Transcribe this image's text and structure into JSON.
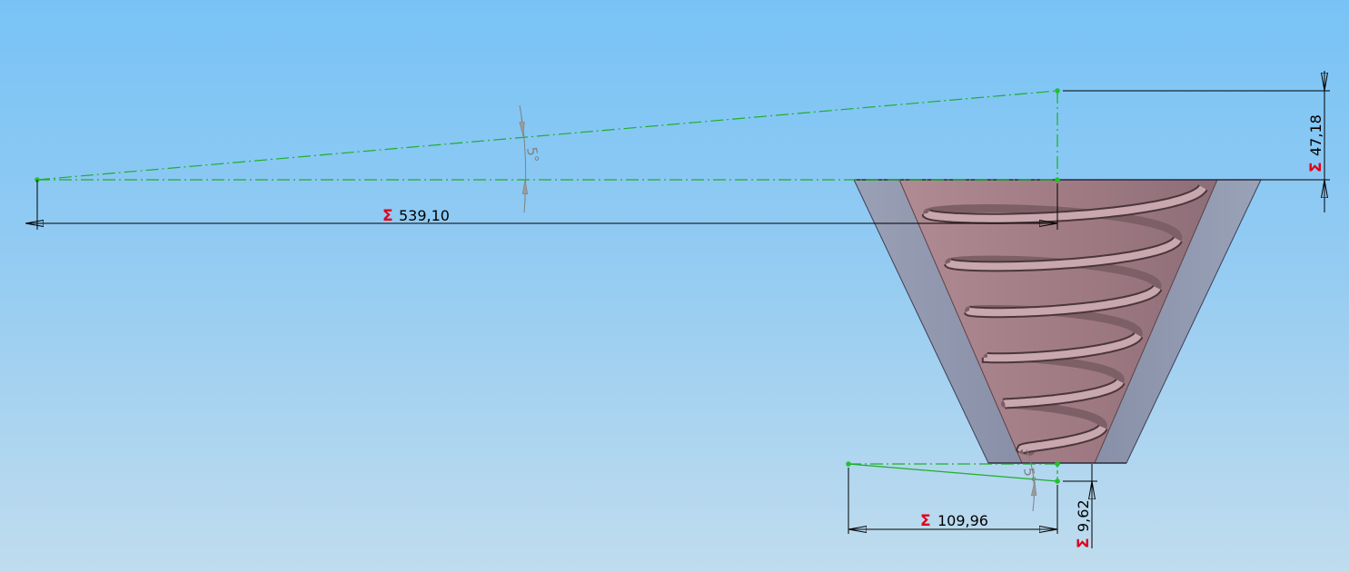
{
  "sigma_symbol": "Σ",
  "dimensions": {
    "top_length": {
      "value": "539,10",
      "driven": true
    },
    "top_height": {
      "value": "47,18",
      "driven": true
    },
    "bottom_length": {
      "value": "109,96",
      "driven": true
    },
    "bottom_height": {
      "value": "9,62",
      "driven": true
    },
    "top_angle": {
      "value": "5°"
    },
    "bottom_angle": {
      "value": "5°"
    }
  },
  "colors": {
    "background_top": "#78c3f6",
    "background_bottom": "#c0dcee",
    "sketch_line": "#1fae2a",
    "sketch_point": "#22c02e",
    "dimension_line": "#000000",
    "angle_dimension": "#808080",
    "sigma": "#e0001a",
    "outer_cone": "#8e96ad",
    "inner_cone": "#a87f88",
    "spiral_thread": "#b7939c"
  }
}
